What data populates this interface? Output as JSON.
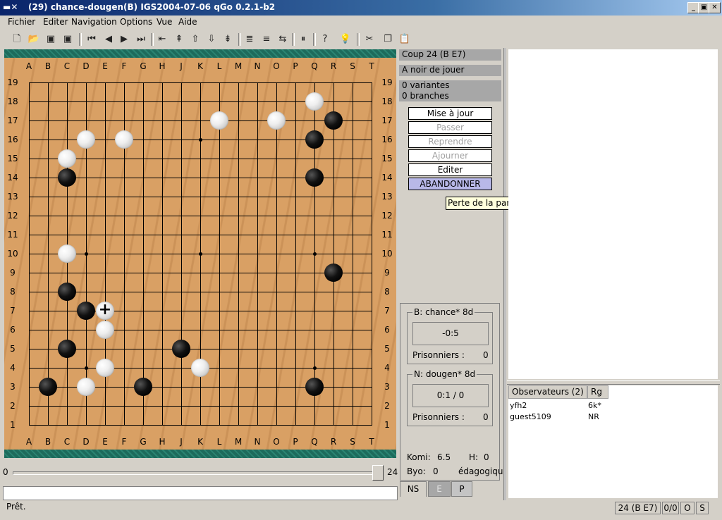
{
  "window": {
    "title": "(29)  chance-dougen(B) IGS2004-07-06   qGo 0.2.1-b2"
  },
  "menu": [
    "Fichier",
    "Editer",
    "Navigation",
    "Options",
    "Vue",
    "Aide"
  ],
  "toolbar_icons": [
    "new-file-icon",
    "open-folder-icon",
    "save-icon",
    "save-as-icon",
    "first-move-icon",
    "previous-move-icon",
    "next-move-icon",
    "last-move-icon",
    "previous-variation-icon",
    "main-branch-icon",
    "up-variation-icon",
    "down-variation-icon",
    "next-branch-icon",
    "previous-comment-icon",
    "next-comment-icon",
    "swap-icon",
    "pause-icon",
    "whats-this-icon",
    "hint-icon",
    "cut-icon",
    "copy-icon",
    "paste-icon"
  ],
  "board": {
    "columns": [
      "A",
      "B",
      "C",
      "D",
      "E",
      "F",
      "G",
      "H",
      "J",
      "K",
      "L",
      "M",
      "N",
      "O",
      "P",
      "Q",
      "R",
      "S",
      "T"
    ],
    "rows": [
      "19",
      "18",
      "17",
      "16",
      "15",
      "14",
      "13",
      "12",
      "11",
      "10",
      "9",
      "8",
      "7",
      "6",
      "5",
      "4",
      "3",
      "2",
      "1"
    ],
    "black_stones": [
      "R17",
      "Q16",
      "C14",
      "Q14",
      "R9",
      "C8",
      "D7",
      "C5",
      "J5",
      "B3",
      "G3",
      "Q3"
    ],
    "white_stones": [
      "Q18",
      "L17",
      "O17",
      "D16",
      "F16",
      "C15",
      "C10",
      "E6",
      "E4",
      "K4",
      "D3"
    ],
    "last_move": "E7",
    "last_move_marker": "+"
  },
  "slider": {
    "min": "0",
    "max": "24",
    "value": 24
  },
  "info": {
    "move": "Coup 24 (B E7)",
    "turn": "A noir de jouer",
    "variants": "0 variantes",
    "branches": "0 branches"
  },
  "buttons": {
    "update": "Mise à jour",
    "pass": "Passer",
    "undo": "Reprendre",
    "adjourn": "Ajourner",
    "edit": "Editer",
    "resign": "ABANDONNER"
  },
  "tooltip": "Perte de la partie",
  "white_player": {
    "label": "B: chance* 8d",
    "time": "-0:5",
    "prisoners_label": "Prisonniers :",
    "prisoners": "0"
  },
  "black_player": {
    "label": "N: dougen* 8d",
    "time": "0:1 / 0",
    "prisoners_label": "Prisonniers :",
    "prisoners": "0"
  },
  "game": {
    "komi_label": "Komi:",
    "komi": "6.5",
    "handicap_label": "H:",
    "handicap": "0",
    "byo_label": "Byo:",
    "byo": "0",
    "mode": "édagogiqu"
  },
  "tabs": [
    "NS",
    "E",
    "P"
  ],
  "observers": {
    "header_name": "Observateurs (2)",
    "header_rank": "Rg",
    "rows": [
      {
        "name": "yfh2",
        "rank": "6k*"
      },
      {
        "name": "guest5109",
        "rank": "NR"
      }
    ]
  },
  "status": {
    "text": "Prêt.",
    "move": "24 (B E7)",
    "captures": "0/0",
    "color": "O",
    "mode": "S"
  }
}
